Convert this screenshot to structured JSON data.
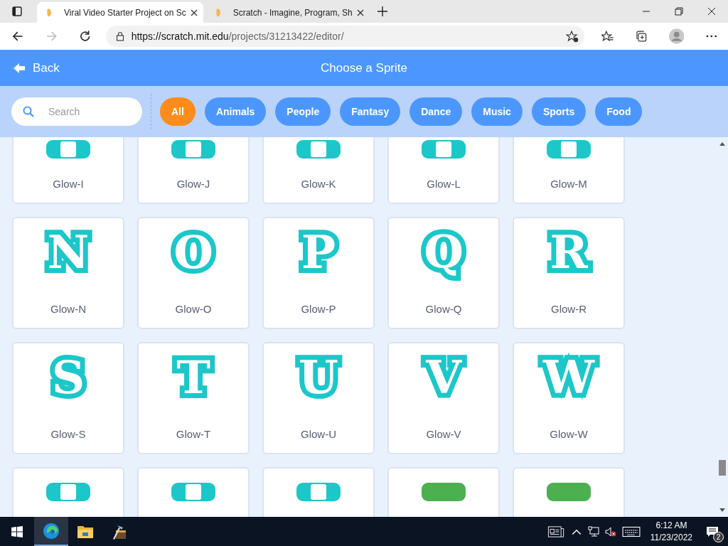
{
  "browser": {
    "tabs": [
      {
        "title": "Viral Video Starter Project on Sc",
        "selected": true
      },
      {
        "title": "Scratch - Imagine, Program, Sh",
        "selected": false
      }
    ],
    "address": {
      "host": "https://scratch.mit.edu",
      "path": "/projects/31213422/editor/"
    }
  },
  "header": {
    "back": "Back",
    "title": "Choose a Sprite"
  },
  "search": {
    "placeholder": "Search"
  },
  "categories": [
    {
      "label": "All",
      "selected": true
    },
    {
      "label": "Animals",
      "selected": false
    },
    {
      "label": "People",
      "selected": false
    },
    {
      "label": "Fantasy",
      "selected": false
    },
    {
      "label": "Dance",
      "selected": false
    },
    {
      "label": "Music",
      "selected": false
    },
    {
      "label": "Sports",
      "selected": false
    },
    {
      "label": "Food",
      "selected": false
    }
  ],
  "sprites": [
    {
      "name": "Glow-I",
      "kind": "glow"
    },
    {
      "name": "Glow-J",
      "kind": "glow"
    },
    {
      "name": "Glow-K",
      "kind": "glow"
    },
    {
      "name": "Glow-L",
      "kind": "glow"
    },
    {
      "name": "Glow-M",
      "kind": "glow"
    },
    {
      "glyph": "N",
      "name": "Glow-N",
      "kind": "glow"
    },
    {
      "glyph": "O",
      "name": "Glow-O",
      "kind": "glow"
    },
    {
      "glyph": "P",
      "name": "Glow-P",
      "kind": "glow"
    },
    {
      "glyph": "Q",
      "name": "Glow-Q",
      "kind": "glow"
    },
    {
      "glyph": "R",
      "name": "Glow-R",
      "kind": "glow"
    },
    {
      "glyph": "S",
      "name": "Glow-S",
      "kind": "glow"
    },
    {
      "glyph": "T",
      "name": "Glow-T",
      "kind": "glow"
    },
    {
      "glyph": "U",
      "name": "Glow-U",
      "kind": "glow"
    },
    {
      "glyph": "V",
      "name": "Glow-V",
      "kind": "glow"
    },
    {
      "glyph": "W",
      "name": "Glow-W",
      "kind": "glow"
    },
    {
      "kind": "glow"
    },
    {
      "kind": "glow"
    },
    {
      "kind": "glow"
    },
    {
      "kind": "classic"
    },
    {
      "kind": "classic"
    }
  ],
  "taskbar": {
    "time": "6:12 AM",
    "date": "11/23/2022",
    "notifications": "2"
  }
}
